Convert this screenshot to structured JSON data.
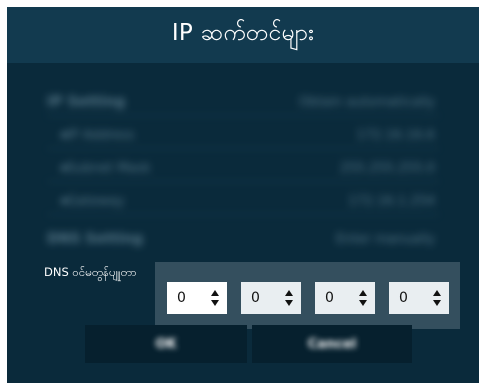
{
  "dialog": {
    "title": "IP ဆက်တင်များ"
  },
  "settings": {
    "ip_setting": {
      "label": "IP Setting",
      "value": "Obtain automatically"
    },
    "ip_address": {
      "label": "IP Address",
      "value": "172.16.16.6"
    },
    "subnet_mask": {
      "label": "Subnet Mask",
      "value": "255.255.255.0"
    },
    "gateway": {
      "label": "Gateway",
      "value": "172.16.1.254"
    },
    "dns_setting": {
      "label": "DNS Setting",
      "value": "Enter manually"
    }
  },
  "dns_server": {
    "label": "DNS ဝင်မတွန်ပျုုတာ",
    "octets": [
      "0",
      "0",
      "0",
      "0"
    ]
  },
  "buttons": {
    "ok": "OK",
    "cancel": "Cancel"
  },
  "colors": {
    "dialog_bg": "#0a2a3b",
    "header_bg": "#123a4f",
    "panel_bg": "#344f5e"
  }
}
